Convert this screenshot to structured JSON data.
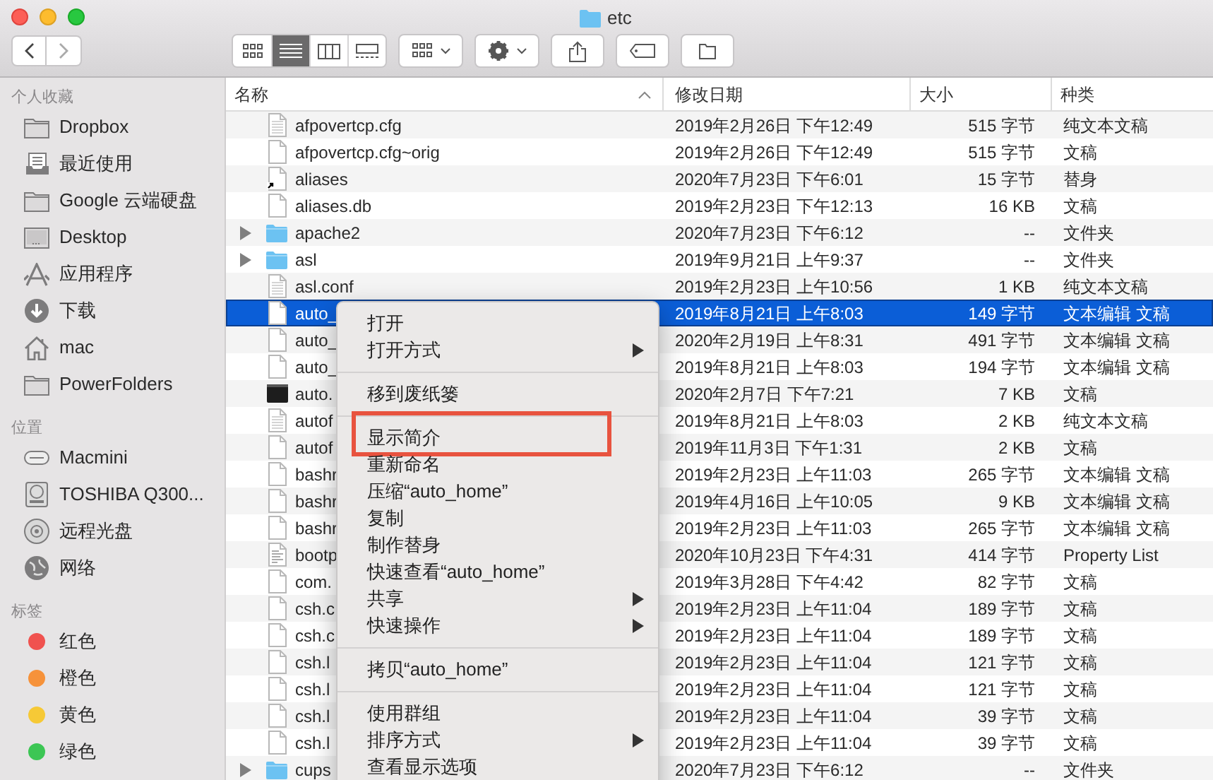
{
  "window": {
    "title": "etc"
  },
  "toolbar": {
    "views": [
      {
        "kind": "icons",
        "selected": false
      },
      {
        "kind": "list",
        "selected": true
      },
      {
        "kind": "columns",
        "selected": false
      },
      {
        "kind": "gallery",
        "selected": false
      }
    ]
  },
  "sidebar": {
    "sections": [
      {
        "title": "个人收藏",
        "items": [
          {
            "label": "Dropbox",
            "kind": "folder"
          },
          {
            "label": "最近使用",
            "kind": "recents"
          },
          {
            "label": "Google 云端硬盘",
            "kind": "folder"
          },
          {
            "label": "Desktop",
            "kind": "desktop"
          },
          {
            "label": "应用程序",
            "kind": "apps"
          },
          {
            "label": "下载",
            "kind": "download"
          },
          {
            "label": "mac",
            "kind": "home"
          },
          {
            "label": "PowerFolders",
            "kind": "folder"
          }
        ]
      },
      {
        "title": "位置",
        "items": [
          {
            "label": "Macmini",
            "kind": "computer"
          },
          {
            "label": "TOSHIBA Q300...",
            "kind": "disk"
          },
          {
            "label": "远程光盘",
            "kind": "disc"
          },
          {
            "label": "网络",
            "kind": "network"
          }
        ]
      },
      {
        "title": "标签",
        "items": [
          {
            "label": "红色",
            "kind": "tag",
            "color": "#f0524f"
          },
          {
            "label": "橙色",
            "kind": "tag",
            "color": "#f6923a"
          },
          {
            "label": "黄色",
            "kind": "tag",
            "color": "#f6c936"
          },
          {
            "label": "绿色",
            "kind": "tag",
            "color": "#3cc654"
          }
        ]
      }
    ]
  },
  "table": {
    "columns": [
      {
        "label": "名称",
        "sorted": true
      },
      {
        "label": "修改日期",
        "sorted": false
      },
      {
        "label": "大小",
        "sorted": false
      },
      {
        "label": "种类",
        "sorted": false
      }
    ],
    "rows": [
      {
        "name": "afpovertcp.cfg",
        "date": "2019年2月26日 下午12:49",
        "size": "515 字节",
        "type": "纯文本文稿",
        "kind": "text",
        "expandable": false,
        "selected": false
      },
      {
        "name": "afpovertcp.cfg~orig",
        "date": "2019年2月26日 下午12:49",
        "size": "515 字节",
        "type": "文稿",
        "kind": "blank",
        "expandable": false,
        "selected": false
      },
      {
        "name": "aliases",
        "date": "2020年7月23日 下午6:01",
        "size": "15 字节",
        "type": "替身",
        "kind": "alias",
        "expandable": false,
        "selected": false
      },
      {
        "name": "aliases.db",
        "date": "2019年2月23日 下午12:13",
        "size": "16 KB",
        "type": "文稿",
        "kind": "blank",
        "expandable": false,
        "selected": false
      },
      {
        "name": "apache2",
        "date": "2020年7月23日 下午6:12",
        "size": "--",
        "type": "文件夹",
        "kind": "folder",
        "expandable": true,
        "selected": false
      },
      {
        "name": "asl",
        "date": "2019年9月21日 上午9:37",
        "size": "--",
        "type": "文件夹",
        "kind": "folder",
        "expandable": true,
        "selected": false
      },
      {
        "name": "asl.conf",
        "date": "2019年2月23日 上午10:56",
        "size": "1 KB",
        "type": "纯文本文稿",
        "kind": "text",
        "expandable": false,
        "selected": false
      },
      {
        "name": "auto_",
        "date": "2019年8月21日 上午8:03",
        "size": "149 字节",
        "type": "文本编辑 文稿",
        "kind": "blank",
        "expandable": false,
        "selected": true
      },
      {
        "name": "auto_",
        "date": "2020年2月19日 上午8:31",
        "size": "491 字节",
        "type": "文本编辑 文稿",
        "kind": "blank",
        "expandable": false,
        "selected": false
      },
      {
        "name": "auto_",
        "date": "2019年8月21日 上午8:03",
        "size": "194 字节",
        "type": "文本编辑 文稿",
        "kind": "blank",
        "expandable": false,
        "selected": false
      },
      {
        "name": "auto.",
        "date": "2020年2月7日 下午7:21",
        "size": "7 KB",
        "type": "文稿",
        "kind": "exec",
        "expandable": false,
        "selected": false
      },
      {
        "name": "autof",
        "date": "2019年8月21日 上午8:03",
        "size": "2 KB",
        "type": "纯文本文稿",
        "kind": "text",
        "expandable": false,
        "selected": false
      },
      {
        "name": "autof",
        "date": "2019年11月3日 下午1:31",
        "size": "2 KB",
        "type": "文稿",
        "kind": "blank",
        "expandable": false,
        "selected": false
      },
      {
        "name": "bashr",
        "date": "2019年2月23日 上午11:03",
        "size": "265 字节",
        "type": "文本编辑 文稿",
        "kind": "blank",
        "expandable": false,
        "selected": false
      },
      {
        "name": "bashr",
        "date": "2019年4月16日 上午10:05",
        "size": "9 KB",
        "type": "文本编辑 文稿",
        "kind": "blank",
        "expandable": false,
        "selected": false
      },
      {
        "name": "bashr",
        "date": "2019年2月23日 上午11:03",
        "size": "265 字节",
        "type": "文本编辑 文稿",
        "kind": "blank",
        "expandable": false,
        "selected": false
      },
      {
        "name": "bootp",
        "date": "2020年10月23日 下午4:31",
        "size": "414 字节",
        "type": "Property List",
        "kind": "plist",
        "expandable": false,
        "selected": false
      },
      {
        "name": "com.",
        "date": "2019年3月28日 下午4:42",
        "size": "82 字节",
        "type": "文稿",
        "kind": "blank",
        "expandable": false,
        "selected": false
      },
      {
        "name": "csh.c",
        "date": "2019年2月23日 上午11:04",
        "size": "189 字节",
        "type": "文稿",
        "kind": "blank",
        "expandable": false,
        "selected": false
      },
      {
        "name": "csh.c",
        "date": "2019年2月23日 上午11:04",
        "size": "189 字节",
        "type": "文稿",
        "kind": "blank",
        "expandable": false,
        "selected": false
      },
      {
        "name": "csh.l",
        "date": "2019年2月23日 上午11:04",
        "size": "121 字节",
        "type": "文稿",
        "kind": "blank",
        "expandable": false,
        "selected": false
      },
      {
        "name": "csh.l",
        "date": "2019年2月23日 上午11:04",
        "size": "121 字节",
        "type": "文稿",
        "kind": "blank",
        "expandable": false,
        "selected": false
      },
      {
        "name": "csh.l",
        "date": "2019年2月23日 上午11:04",
        "size": "39 字节",
        "type": "文稿",
        "kind": "blank",
        "expandable": false,
        "selected": false
      },
      {
        "name": "csh.l",
        "date": "2019年2月23日 上午11:04",
        "size": "39 字节",
        "type": "文稿",
        "kind": "blank",
        "expandable": false,
        "selected": false
      },
      {
        "name": "cups",
        "date": "2020年7月23日 下午6:12",
        "size": "--",
        "type": "文件夹",
        "kind": "folder",
        "expandable": true,
        "selected": false
      }
    ]
  },
  "context_menu": {
    "items": [
      {
        "kind": "item",
        "label": "打开",
        "submenu": false,
        "annotated": false
      },
      {
        "kind": "item",
        "label": "打开方式",
        "submenu": true,
        "annotated": false
      },
      {
        "kind": "separator"
      },
      {
        "kind": "item",
        "label": "移到废纸篓",
        "submenu": false,
        "annotated": false
      },
      {
        "kind": "separator"
      },
      {
        "kind": "item",
        "label": "显示简介",
        "submenu": false,
        "annotated": true
      },
      {
        "kind": "item",
        "label": "重新命名",
        "submenu": false,
        "annotated": false
      },
      {
        "kind": "item",
        "label": "压缩“auto_home”",
        "submenu": false,
        "annotated": false
      },
      {
        "kind": "item",
        "label": "复制",
        "submenu": false,
        "annotated": false
      },
      {
        "kind": "item",
        "label": "制作替身",
        "submenu": false,
        "annotated": false
      },
      {
        "kind": "item",
        "label": "快速查看“auto_home”",
        "submenu": false,
        "annotated": false
      },
      {
        "kind": "item",
        "label": "共享",
        "submenu": true,
        "annotated": false
      },
      {
        "kind": "item",
        "label": "快速操作",
        "submenu": true,
        "annotated": false
      },
      {
        "kind": "separator"
      },
      {
        "kind": "item",
        "label": "拷贝“auto_home”",
        "submenu": false,
        "annotated": false
      },
      {
        "kind": "separator"
      },
      {
        "kind": "item",
        "label": "使用群组",
        "submenu": false,
        "annotated": false
      },
      {
        "kind": "item",
        "label": "排序方式",
        "submenu": true,
        "annotated": false
      },
      {
        "kind": "item",
        "label": "查看显示选项",
        "submenu": false,
        "annotated": false
      }
    ]
  }
}
